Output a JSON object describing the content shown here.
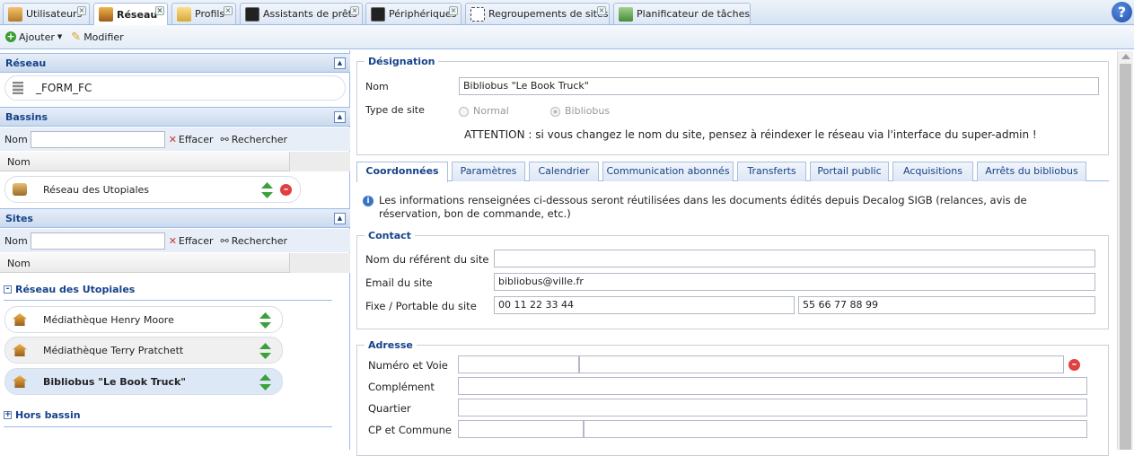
{
  "tabs": [
    {
      "label": "Utilisateurs",
      "icon": "users-icon"
    },
    {
      "label": "Réseau",
      "icon": "home-icon"
    },
    {
      "label": "Profils",
      "icon": "folder-icon"
    },
    {
      "label": "Assistants de prêts",
      "icon": "terminal-icon"
    },
    {
      "label": "Périphériques",
      "icon": "terminal-icon"
    },
    {
      "label": "Regroupements de sites",
      "icon": "group-icon"
    },
    {
      "label": "Planificateur de tâches",
      "icon": "scheduler-icon"
    }
  ],
  "help": "?",
  "toolbar": {
    "add": "Ajouter",
    "edit": "Modifier"
  },
  "reseau": {
    "title": "Réseau",
    "item": "_FORM_FC"
  },
  "bassins": {
    "title": "Bassins",
    "name_label": "Nom",
    "clear": "Effacer",
    "search": "Rechercher",
    "col": "Nom",
    "item": "Réseau des Utopiales"
  },
  "sites": {
    "title": "Sites",
    "name_label": "Nom",
    "clear": "Effacer",
    "search": "Rechercher",
    "col": "Nom",
    "group": "Réseau des Utopiales",
    "items": [
      "Médiathèque Henry Moore",
      "Médiathèque Terry Pratchett",
      "Bibliobus \"Le Book Truck\""
    ],
    "other_group": "Hors bassin"
  },
  "designation": {
    "legend": "Désignation",
    "name_label": "Nom",
    "name_value": "Bibliobus \"Le Book Truck\"",
    "type_label": "Type de site",
    "type_options": [
      "Normal",
      "Bibliobus"
    ],
    "warning": "ATTENTION : si vous changez le nom du site, pensez à réindexer le réseau via l'interface du super-admin !"
  },
  "subtabs": [
    "Coordonnées",
    "Paramètres",
    "Calendrier",
    "Communication abonnés",
    "Transferts",
    "Portail public",
    "Acquisitions",
    "Arrêts du bibliobus"
  ],
  "info": "Les informations renseignées ci-dessous seront réutilisées dans les documents édités depuis Decalog SIGB (relances, avis de réservation, bon de commande, etc.)",
  "contact": {
    "legend": "Contact",
    "referent_label": "Nom du référent du site",
    "referent_value": "",
    "email_label": "Email du site",
    "email_value": "bibliobus@ville.fr",
    "phone_label": "Fixe / Portable du site",
    "phone_fixe": "00 11 22 33 44",
    "phone_mobile": "55 66 77 88 99"
  },
  "adresse": {
    "legend": "Adresse",
    "voie_label": "Numéro et Voie",
    "complement_label": "Complément",
    "quartier_label": "Quartier",
    "cp_label": "CP et Commune"
  }
}
